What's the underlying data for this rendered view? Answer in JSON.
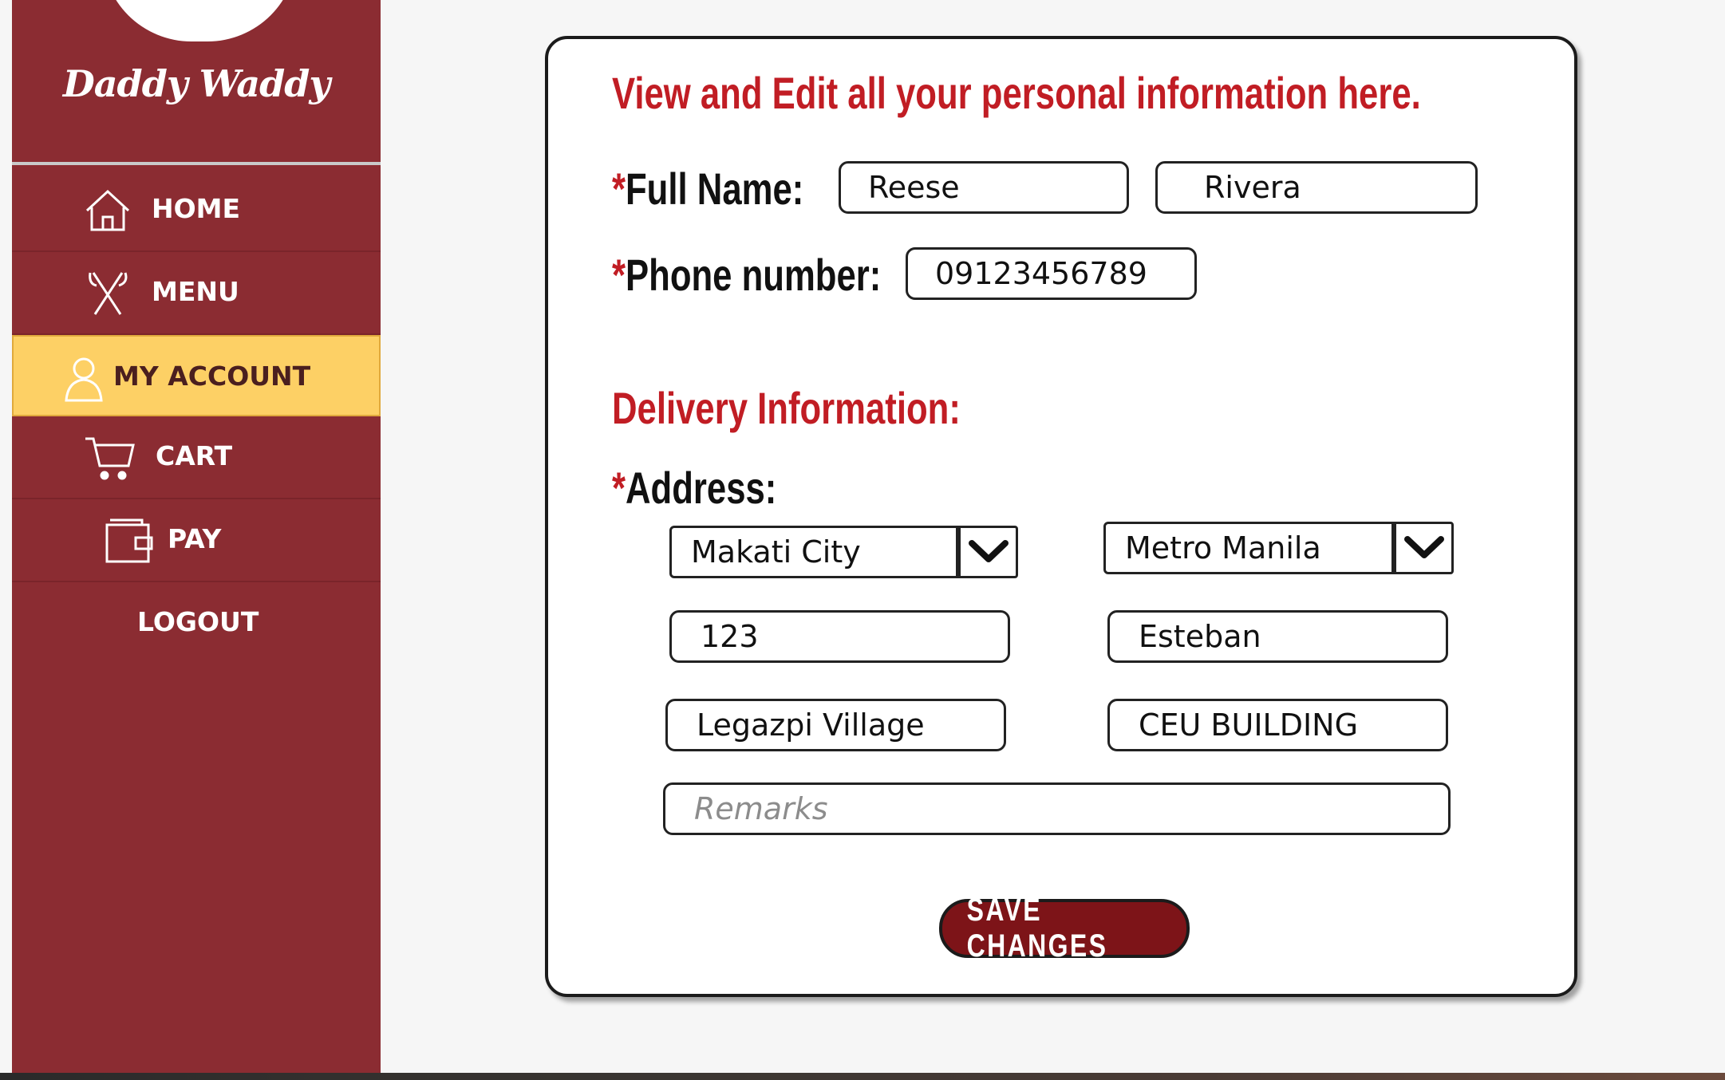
{
  "brand": {
    "name": "Daddy Waddy"
  },
  "nav": {
    "items": [
      {
        "label": "HOME",
        "icon": "home-icon"
      },
      {
        "label": "MENU",
        "icon": "utensils-icon"
      },
      {
        "label": "MY ACCOUNT",
        "icon": "user-icon",
        "active": true
      },
      {
        "label": "CART",
        "icon": "cart-icon"
      },
      {
        "label": "PAY",
        "icon": "wallet-icon"
      },
      {
        "label": "LOGOUT"
      }
    ]
  },
  "form": {
    "title": "View and Edit all your personal information here.",
    "full_name_label": "Full Name:",
    "phone_label": "Phone number:",
    "delivery_heading": "Delivery Information:",
    "address_label": "Address:",
    "required_mark": "*",
    "first_name": "Reese",
    "last_name": "Rivera",
    "phone": "09123456789",
    "city": "Makati City",
    "region": "Metro Manila",
    "house_no": "123",
    "street": "Esteban",
    "barangay": "Legazpi Village",
    "building": "CEU BUILDING",
    "remarks_placeholder": "Remarks",
    "save_label": "SAVE CHANGES"
  },
  "colors": {
    "sidebar": "#8b2c32",
    "active_nav": "#fdd065",
    "accent_red": "#c11d24",
    "button": "#7d1418"
  }
}
